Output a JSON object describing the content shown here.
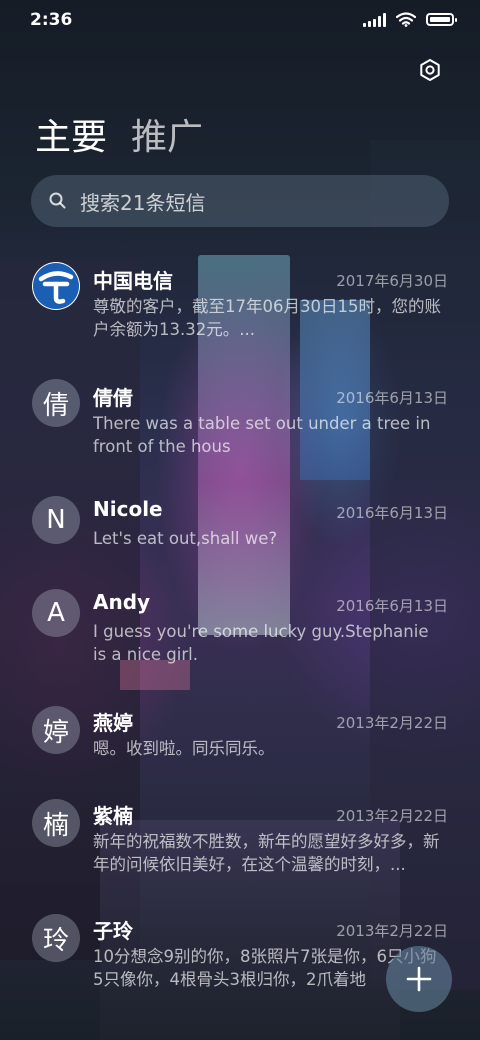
{
  "status_bar": {
    "time": "2:36"
  },
  "tabs": [
    {
      "label": "主要",
      "active": true
    },
    {
      "label": "推广",
      "active": false
    }
  ],
  "search": {
    "placeholder": "搜索21条短信"
  },
  "conversations": [
    {
      "name": "中国电信",
      "date": "2017年6月30日",
      "avatar_text": "",
      "avatar_icon": "china-telecom-logo",
      "snippet": "尊敬的客户，截至17年06月30日15时，您的账户余额为13.32元。..."
    },
    {
      "name": "倩倩",
      "date": "2016年6月13日",
      "avatar_text": "倩",
      "snippet": "There was a table set out under a tree in front of the hous"
    },
    {
      "name": "Nicole",
      "date": "2016年6月13日",
      "avatar_text": "N",
      "snippet": "Let's eat out,shall we?"
    },
    {
      "name": "Andy",
      "date": "2016年6月13日",
      "avatar_text": "A",
      "snippet": "I guess you're some lucky guy.Stephanie is a nice girl."
    },
    {
      "name": "燕婷",
      "date": "2013年2月22日",
      "avatar_text": "婷",
      "snippet": "嗯。收到啦。同乐同乐。"
    },
    {
      "name": "紫楠",
      "date": "2013年2月22日",
      "avatar_text": "楠",
      "snippet": "新年的祝福数不胜数，新年的愿望好多好多，新年的问候依旧美好，在这个温馨的时刻，..."
    },
    {
      "name": "子玲",
      "date": "2013年2月22日",
      "avatar_text": "玲",
      "snippet": "10分想念9别的你，8张照片7张是你，6只小狗5只像你，4根骨头3根归你，2爪着地"
    }
  ],
  "icons": {
    "settings": "settings-icon",
    "search": "search-icon",
    "compose": "plus-icon"
  },
  "colors": {
    "telecom_blue": "#1a5fb4"
  }
}
